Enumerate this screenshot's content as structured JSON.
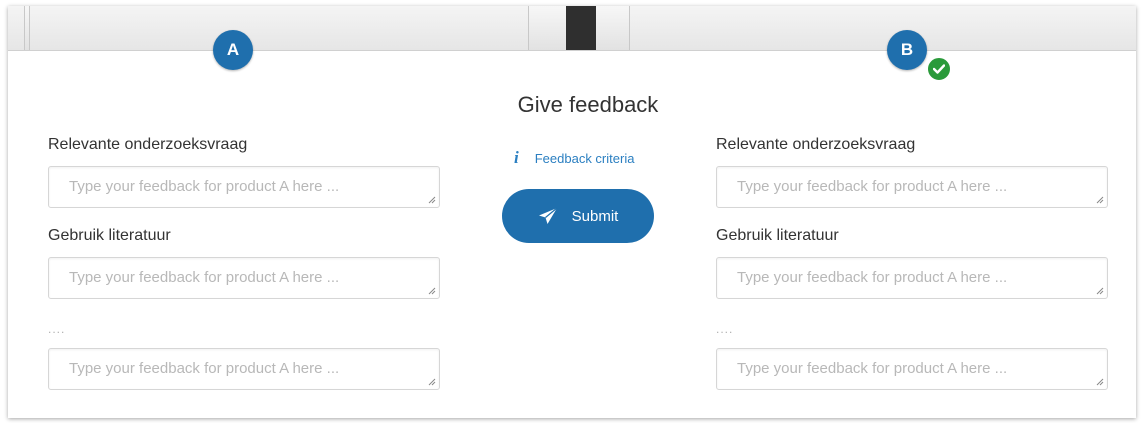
{
  "panels": {
    "left": {
      "badge": "A",
      "fields": [
        {
          "label": "Relevante onderzoeksvraag",
          "placeholder": "Type your feedback for product A here ..."
        },
        {
          "label": "Gebruik literatuur",
          "placeholder": "Type your feedback for product A here ..."
        },
        {
          "label": "....",
          "placeholder": "Type your feedback for product A here ..."
        }
      ]
    },
    "right": {
      "badge": "B",
      "status": "completed",
      "fields": [
        {
          "label": "Relevante onderzoeksvraag",
          "placeholder": "Type your feedback for product A here ..."
        },
        {
          "label": "Gebruik literatuur",
          "placeholder": "Type your feedback for product A here ..."
        },
        {
          "label": "....",
          "placeholder": "Type your feedback for product A here ..."
        }
      ]
    }
  },
  "center": {
    "title": "Give feedback",
    "criteria_icon": "i",
    "criteria_label": "Feedback criteria",
    "submit_label": "Submit",
    "submit_icon": "paper-plane-icon"
  },
  "icons": {
    "badge_check": "checkmark-icon",
    "info": "info-icon"
  },
  "colors": {
    "primary": "#1f6fad",
    "link": "#2b7fc1",
    "success": "#2a9a3a"
  }
}
